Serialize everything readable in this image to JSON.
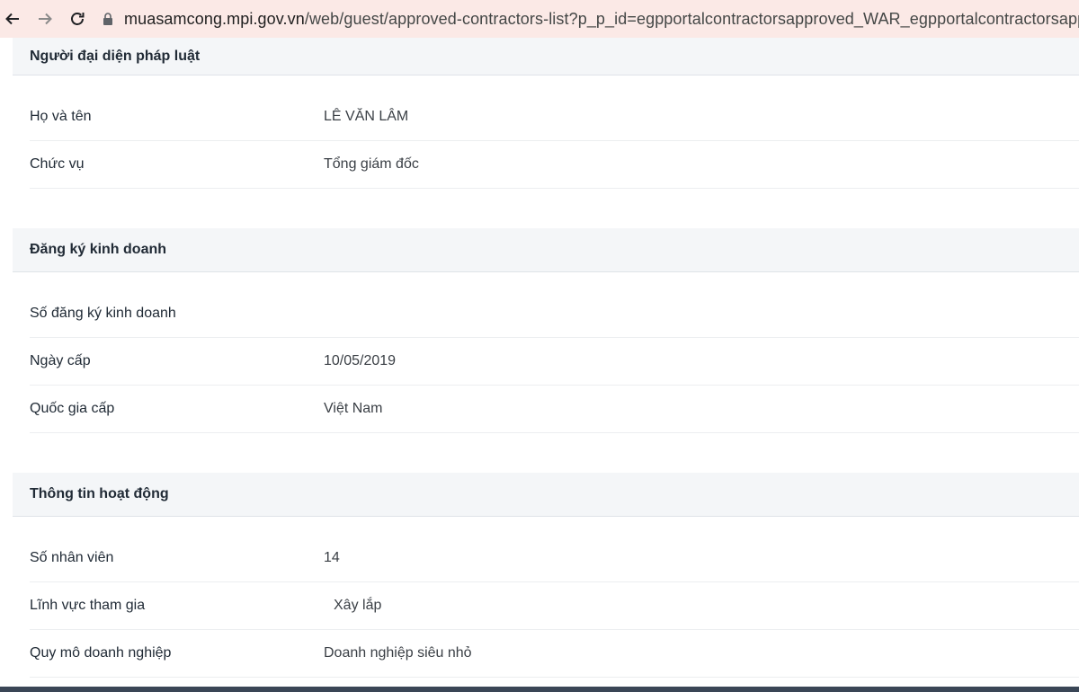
{
  "browser": {
    "url_host": "muasamcong.mpi.gov.vn",
    "url_path": "/web/guest/approved-contractors-list?p_p_id=egpportalcontractorsapproved_WAR_egpportalcontractorsapprove..."
  },
  "sections": {
    "legal": {
      "title": "Người đại diện pháp luật",
      "rows": [
        {
          "label": "Họ và tên",
          "value": "LÊ VĂN LÂM"
        },
        {
          "label": "Chức vụ",
          "value": "Tổng giám đốc"
        }
      ]
    },
    "business": {
      "title": "Đăng ký kinh doanh",
      "rows": [
        {
          "label": "Số đăng ký kinh doanh",
          "value": ""
        },
        {
          "label": "Ngày cấp",
          "value": "10/05/2019"
        },
        {
          "label": "Quốc gia cấp",
          "value": "Việt Nam"
        }
      ]
    },
    "operation": {
      "title": "Thông tin hoạt động",
      "rows": [
        {
          "label": "Số nhân viên",
          "value": "14"
        },
        {
          "label": "Lĩnh vực tham gia",
          "value": "Xây lắp"
        },
        {
          "label": "Quy mô doanh nghiệp",
          "value": "Doanh nghiệp siêu nhỏ"
        }
      ]
    }
  }
}
